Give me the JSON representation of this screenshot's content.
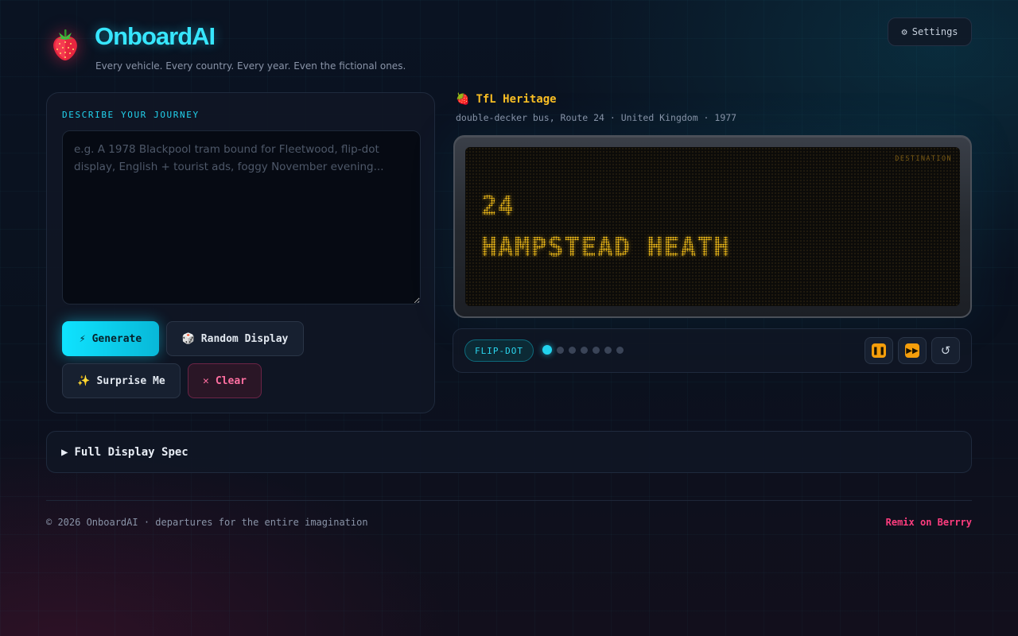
{
  "header": {
    "brand": "OnboardAI",
    "tagline": "Every vehicle. Every country. Every year. Even the fictional ones.",
    "logo_icon": "strawberry-icon",
    "settings_label": "Settings",
    "settings_icon": "gear-icon"
  },
  "composer": {
    "label": "DESCRIBE YOUR JOURNEY",
    "input_value": "",
    "input_placeholder": "e.g. A 1978 Blackpool tram bound for Fleetwood, flip-dot display, English + tourist ads, foggy November evening...",
    "generate_label": "Generate",
    "random_label": "Random Display",
    "surprise_label": "Surprise Me",
    "clear_label": "Clear"
  },
  "vehicle": {
    "operator": "TfL Heritage",
    "meta": "double-decker bus, Route 24 · United Kingdom · 1977"
  },
  "display": {
    "corner_label": "DESTINATION",
    "lines": [
      "24",
      "HAMPSTEAD HEATH"
    ],
    "color": "#fcc419"
  },
  "controls": {
    "mode": "FLIP-DOT",
    "page_count": 7,
    "active_page": 1,
    "pause_icon": "pause-icon",
    "next_icon": "skip-forward-icon",
    "reset_icon": "refresh-icon"
  },
  "spec": {
    "label": "Full Display Spec"
  },
  "footer": {
    "copyright": "© 2026 OnboardAI · departures for the entire imagination",
    "remix": "Remix on Berrry"
  },
  "colors": {
    "accent": "#22d3ee",
    "warning": "#fbbf24",
    "danger": "#ff3d7f"
  }
}
